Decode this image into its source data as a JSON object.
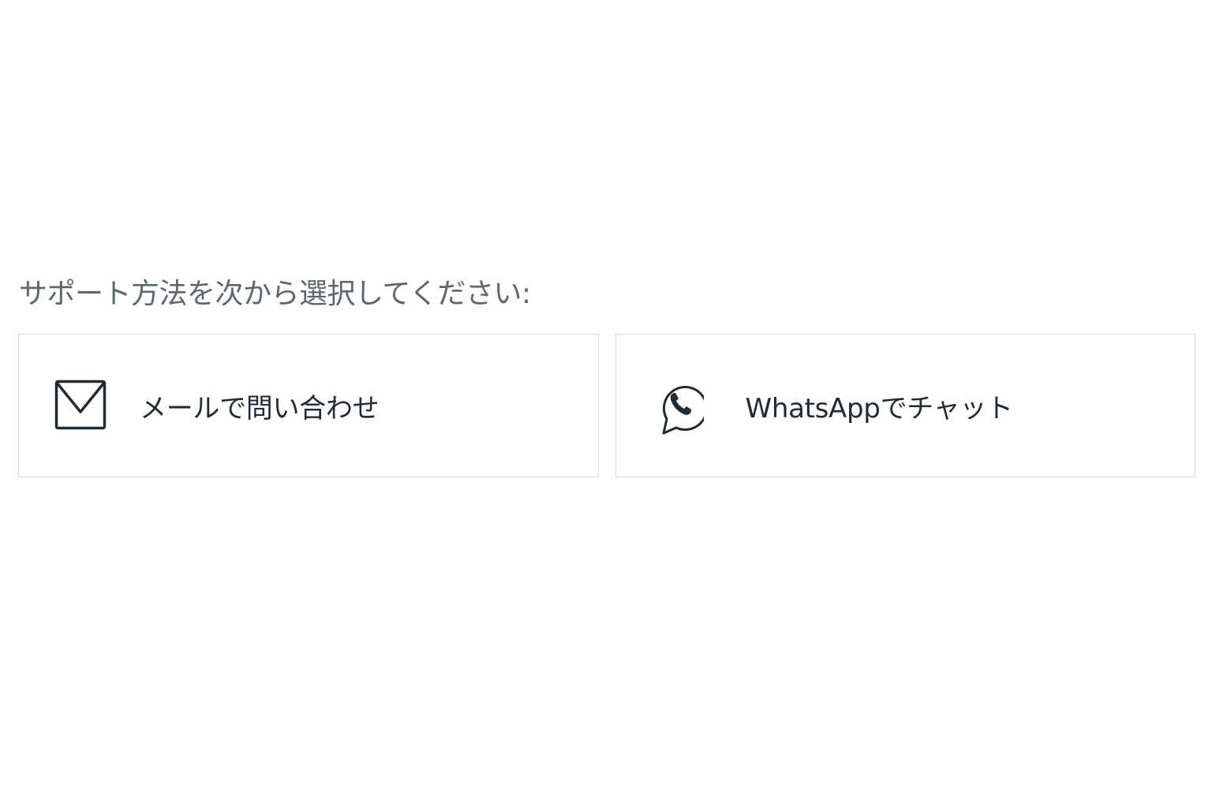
{
  "prompt": {
    "text": "サポート方法を次から選択してください:"
  },
  "options": [
    {
      "icon": "mail-icon",
      "label": "メールで問い合わせ"
    },
    {
      "icon": "whatsapp-icon",
      "label": "WhatsAppでチャット"
    }
  ],
  "colors": {
    "prompt_text": "#5f676d",
    "label_text": "#232b30",
    "card_border": "#d9dcde",
    "icon_stroke": "#232b30",
    "background": "#ffffff"
  }
}
